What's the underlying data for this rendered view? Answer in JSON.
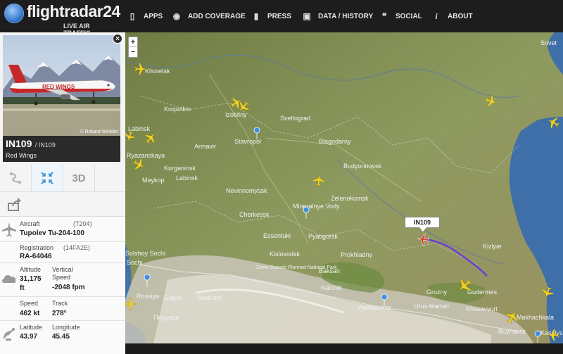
{
  "header": {
    "brand": "flightradar24",
    "tagline": "LIVE AIR TRAFFIC",
    "nav": [
      {
        "label": "APPS",
        "icon": "phone-icon"
      },
      {
        "label": "ADD COVERAGE",
        "icon": "eye-icon"
      },
      {
        "label": "PRESS",
        "icon": "document-icon"
      },
      {
        "label": "DATA / HISTORY",
        "icon": "box-icon"
      },
      {
        "label": "SOCIAL",
        "icon": "quote-icon"
      },
      {
        "label": "ABOUT",
        "icon": "info-icon"
      }
    ]
  },
  "photo": {
    "credit": "© Roland Winkler",
    "livery": "RED WINGS"
  },
  "flight": {
    "callsign": "IN109",
    "flight_number": "/ IN109",
    "airline": "Red Wings"
  },
  "tools": {
    "three_d": "3D"
  },
  "aircraft": {
    "label": "Aircraft",
    "code": "(T204)",
    "model": "Tupolev Tu-204-100"
  },
  "registration": {
    "label": "Registration",
    "code": "(14FA2E)",
    "value": "RA-64046"
  },
  "altitude": {
    "label": "Altitude",
    "value": "31,175",
    "unit": "ft"
  },
  "vspeed": {
    "label1": "Vertical",
    "label2": "Speed",
    "value": "-2048 fpm"
  },
  "speed": {
    "label": "Speed",
    "value": "462 kt"
  },
  "track": {
    "label": "Track",
    "value": "278°"
  },
  "latitude": {
    "label": "Latitude",
    "value": "43.97"
  },
  "longitude": {
    "label": "Longitude",
    "value": "45.45"
  },
  "map": {
    "zoom_in": "+",
    "zoom_out": "−",
    "selected_flight": "IN109",
    "cities": [
      "Khoretsk",
      "Kropotkin",
      "Izobilny",
      "Svetlograd",
      "Labinsk",
      "Armavir",
      "Stavropol",
      "Blagodarny",
      "Ryazanskaya",
      "Kurganinsk",
      "Labinsk",
      "Budyonnovsk",
      "Maykop",
      "Nevinnomyssk",
      "Zelenokumsk",
      "Cherkessk",
      "Mineralnye Vody",
      "Essentuki",
      "Pyatigorsk",
      "Kislovodsk",
      "Prokhladny",
      "Kizlyar",
      "Zemo Svaneti Planned National Park",
      "Baksan",
      "Nalchik",
      "Solshoy Sochi",
      "Sochi",
      "Rossiya",
      "Gagre",
      "Sukhumi",
      "Пицунда",
      "Vladikavkaz",
      "Grozny",
      "Urus-Martan",
      "Gudermes",
      "Khasavyurt",
      "Makhachkala",
      "Kaspiysk",
      "Buynaksk",
      "Sovet"
    ],
    "colors": {
      "land": "#8c9a5e",
      "mountain": "#c9c6b8",
      "sea": "#3f6fa8",
      "plane": "#f5d321",
      "selected_plane": "#e03a3a",
      "trail": "#6a3fd6"
    }
  }
}
